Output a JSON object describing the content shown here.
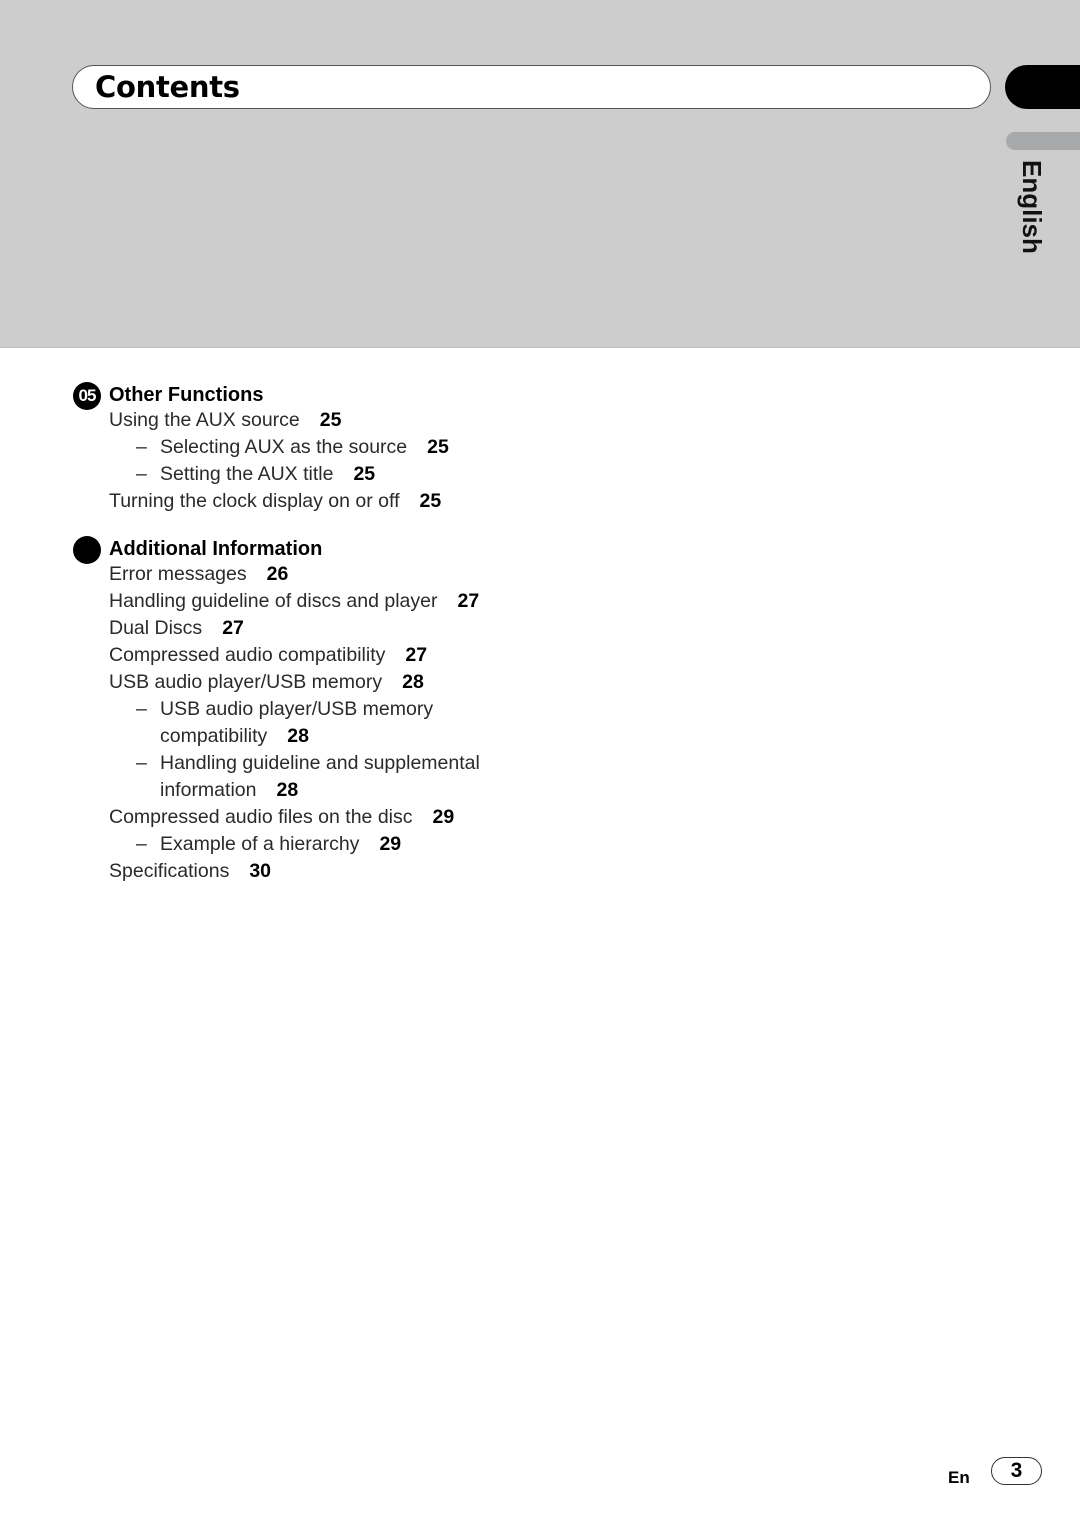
{
  "header": {
    "title": "Contents",
    "language_tab": "English"
  },
  "sections": [
    {
      "badge": "05",
      "title": "Other Functions",
      "entries": [
        {
          "label": "Using the AUX source",
          "page": "25",
          "level": 1
        },
        {
          "label": "Selecting AUX as the source",
          "page": "25",
          "level": 2
        },
        {
          "label": "Setting the AUX title",
          "page": "25",
          "level": 2
        },
        {
          "label": "Turning the clock display on or off",
          "page": "25",
          "level": 1
        }
      ]
    },
    {
      "badge": "",
      "title": "Additional Information",
      "entries": [
        {
          "label": "Error messages",
          "page": "26",
          "level": 1
        },
        {
          "label": "Handling guideline of discs and player",
          "page": "27",
          "level": 1
        },
        {
          "label": "Dual Discs",
          "page": "27",
          "level": 1
        },
        {
          "label": "Compressed audio compatibility",
          "page": "27",
          "level": 1
        },
        {
          "label": "USB audio player/USB memory",
          "page": "28",
          "level": 1
        },
        {
          "label": "USB audio player/USB memory",
          "label_cont": "compatibility",
          "page": "28",
          "level": 2
        },
        {
          "label": "Handling guideline and supplemental",
          "label_cont": "information",
          "page": "28",
          "level": 2
        },
        {
          "label": "Compressed audio files on the disc",
          "page": "29",
          "level": 1
        },
        {
          "label": "Example of a hierarchy",
          "page": "29",
          "level": 2
        },
        {
          "label": "Specifications",
          "page": "30",
          "level": 1
        }
      ]
    }
  ],
  "dash_glyph": "–",
  "footer": {
    "lang_code": "En",
    "page_number": "3"
  }
}
